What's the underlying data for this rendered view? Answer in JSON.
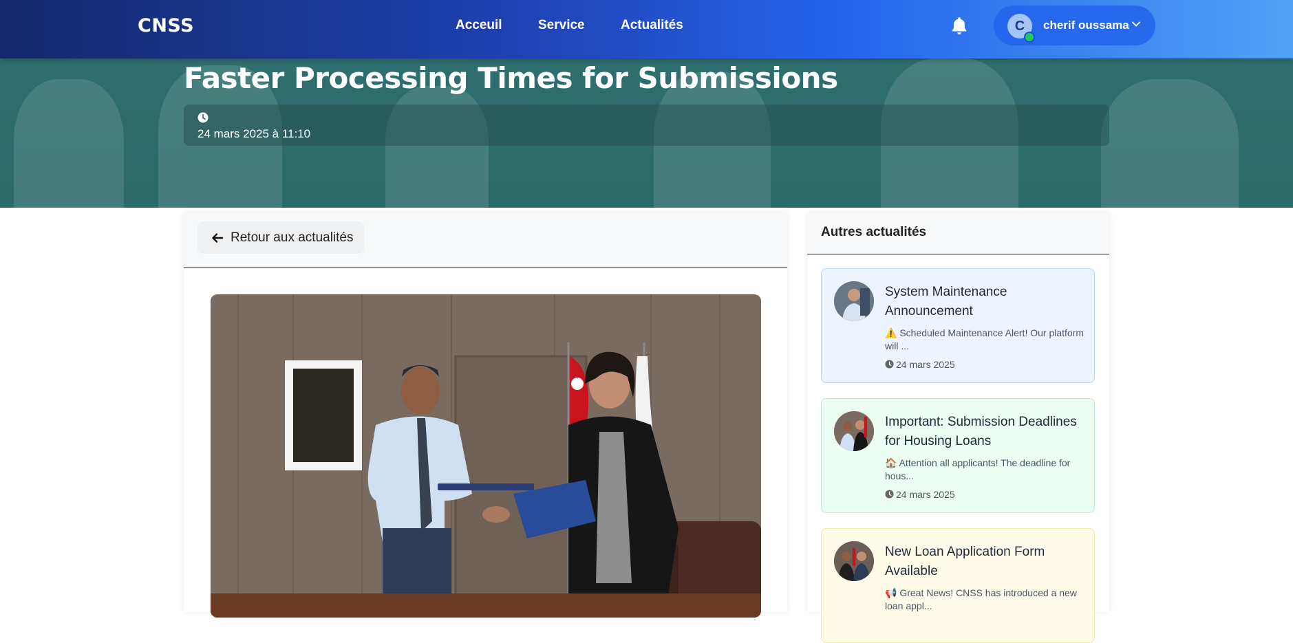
{
  "navbar": {
    "brand": "CNSS",
    "links": [
      "Acceuil",
      "Service",
      "Actualités"
    ],
    "user": {
      "initial": "C",
      "name": "cherif oussama"
    }
  },
  "hero": {
    "title": "Faster Processing Times for Submissions",
    "date": "24 mars 2025 à 11:10"
  },
  "main": {
    "back_label": "Retour aux actualités"
  },
  "sidebar": {
    "title": "Autres actualités",
    "items": [
      {
        "title": "System Maintenance Announcement",
        "excerpt": "⚠️ Scheduled Maintenance Alert! Our platform will ...",
        "date": "24 mars 2025",
        "bg": "#eef4ff",
        "border": "#bfd4f5"
      },
      {
        "title": "Important: Submission Deadlines for Housing Loans",
        "excerpt": "🏠 Attention all applicants! The deadline for hous...",
        "date": "24 mars 2025",
        "bg": "#ecfdf3",
        "border": "#bbefd0"
      },
      {
        "title": "New Loan Application Form Available",
        "excerpt": "📢 Great News! CNSS has introduced a new loan appl...",
        "date": "",
        "bg": "#fefce8",
        "border": "#f4e9a8"
      }
    ]
  },
  "icons": {
    "bell": "bell-icon",
    "clock": "clock-icon",
    "back": "arrow-left-icon",
    "chevron": "chevron-down-icon"
  }
}
